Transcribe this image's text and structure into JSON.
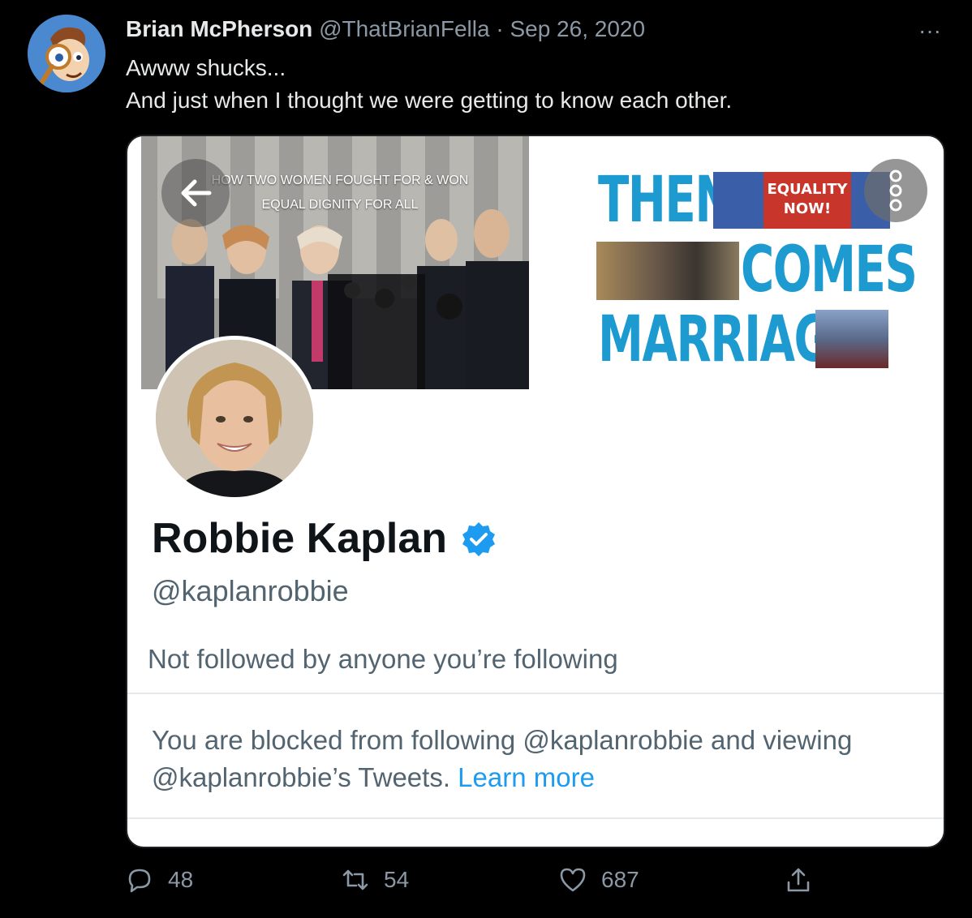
{
  "tweet": {
    "author_name": "Brian McPherson",
    "author_meta": "@ThatBrianFella · Sep 26, 2020",
    "more_label": "···",
    "text": "Awww shucks...\nAnd just when I thought we were getting to know each other."
  },
  "card": {
    "banner_caption": "HOW TWO WOMEN FOUGHT FOR & WON EQUAL DIGNITY FOR ALL",
    "book_title": {
      "word1": "THEN",
      "word2": "COMES",
      "word3": "MARRIAGE",
      "sign_text": "EQUALITY NOW!"
    },
    "profile_name": "Robbie Kaplan",
    "profile_handle": "@kaplanrobbie",
    "followers_note": "Not followed by anyone you’re following",
    "blocked_text": "You are blocked from following @kaplanrobbie and viewing @kaplanrobbie’s Tweets.",
    "learn_more": "Learn more"
  },
  "actions": {
    "replies": "48",
    "retweets": "54",
    "likes": "687"
  },
  "icons": {
    "back": "arrow-left-icon",
    "more": "more-vertical-icon",
    "verified": "verified-badge-icon",
    "reply": "reply-icon",
    "retweet": "retweet-icon",
    "like": "heart-icon",
    "share": "share-icon"
  },
  "colors": {
    "accent": "#1d9bf0",
    "background": "#000000",
    "card_bg": "#ffffff",
    "muted": "#536471"
  }
}
